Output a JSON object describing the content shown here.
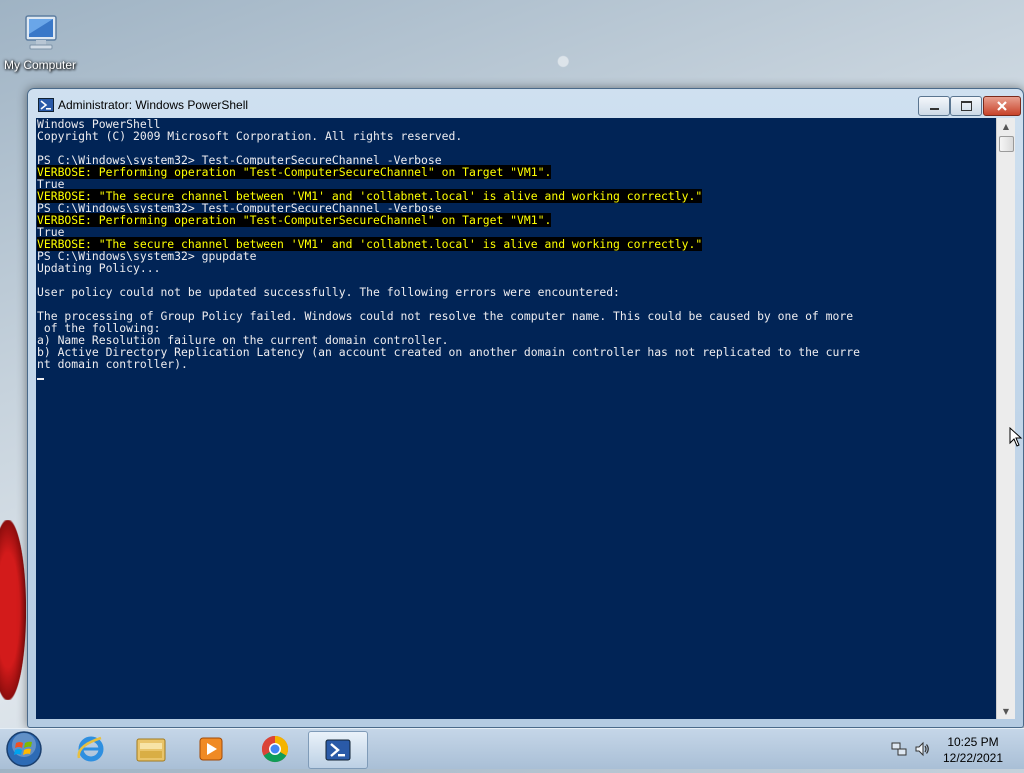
{
  "desktop": {
    "icons": [
      {
        "label": "My Computer",
        "icon": "computer-icon"
      }
    ]
  },
  "window": {
    "title": "Administrator: Windows PowerShell",
    "icon": "powershell-icon",
    "controls": [
      "minimize-icon",
      "maximize-icon",
      "close-icon"
    ]
  },
  "console": {
    "background": "#012456",
    "text_color": "#eeedf0",
    "verbose_color": "#ffff00",
    "lines": [
      {
        "text": "Windows PowerShell",
        "type": "normal"
      },
      {
        "text": "Copyright (C) 2009 Microsoft Corporation. All rights reserved.",
        "type": "normal"
      },
      {
        "text": "",
        "type": "normal"
      },
      {
        "text": "PS C:\\Windows\\system32> Test-ComputerSecureChannel -Verbose",
        "type": "normal"
      },
      {
        "text": "VERBOSE: Performing operation \"Test-ComputerSecureChannel\" on Target \"VM1\".",
        "type": "verbose"
      },
      {
        "text": "True",
        "type": "normal"
      },
      {
        "text": "VERBOSE: \"The secure channel between 'VM1' and 'collabnet.local' is alive and working correctly.\"",
        "type": "verbose"
      },
      {
        "text": "PS C:\\Windows\\system32> Test-ComputerSecureChannel -Verbose",
        "type": "normal"
      },
      {
        "text": "VERBOSE: Performing operation \"Test-ComputerSecureChannel\" on Target \"VM1\".",
        "type": "verbose"
      },
      {
        "text": "True",
        "type": "normal"
      },
      {
        "text": "VERBOSE: \"The secure channel between 'VM1' and 'collabnet.local' is alive and working correctly.\"",
        "type": "verbose"
      },
      {
        "text": "PS C:\\Windows\\system32> gpupdate",
        "type": "normal"
      },
      {
        "text": "Updating Policy...",
        "type": "normal"
      },
      {
        "text": "",
        "type": "normal"
      },
      {
        "text": "User policy could not be updated successfully. The following errors were encountered:",
        "type": "normal"
      },
      {
        "text": "",
        "type": "normal"
      },
      {
        "text": "The processing of Group Policy failed. Windows could not resolve the computer name. This could be caused by one of more",
        "type": "normal"
      },
      {
        "text": " of the following:",
        "type": "normal"
      },
      {
        "text": "a) Name Resolution failure on the current domain controller.",
        "type": "normal"
      },
      {
        "text": "b) Active Directory Replication Latency (an account created on another domain controller has not replicated to the curre",
        "type": "normal"
      },
      {
        "text": "nt domain controller).",
        "type": "normal"
      },
      {
        "text": "",
        "type": "cursor"
      }
    ]
  },
  "taskbar": {
    "start_icon": "windows-start-icon",
    "items": [
      {
        "name": "internet-explorer-icon"
      },
      {
        "name": "windows-explorer-icon"
      },
      {
        "name": "media-player-icon"
      },
      {
        "name": "chrome-icon"
      },
      {
        "name": "powershell-icon",
        "active": true
      }
    ],
    "tray": {
      "icons": [
        "network-icon",
        "volume-icon"
      ],
      "time": "10:25 PM",
      "date": "12/22/2021"
    }
  }
}
